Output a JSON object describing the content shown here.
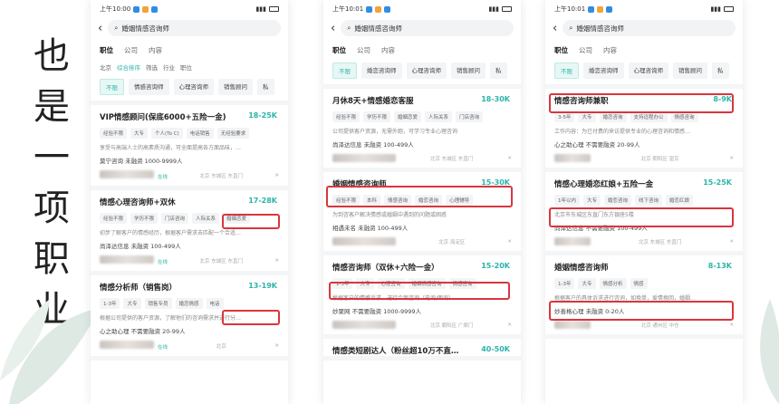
{
  "slide": {
    "vertical_text": [
      "也",
      "是",
      "一",
      "项",
      "职",
      "业"
    ]
  },
  "phones": [
    {
      "time": "上午10:00",
      "search_query": "婚姻情感咨询师",
      "tabs": [
        "职位",
        "公司",
        "内容"
      ],
      "filters": [
        "北京",
        "综合排序",
        "筛选",
        "行业",
        "职位"
      ],
      "chips": [
        "不限",
        "情感咨询师",
        "心理咨询师",
        "销售顾问",
        "私"
      ],
      "cards": [
        {
          "title": "VIP情感顾问(保底6000+五险一金)",
          "salary": "18-25K",
          "tags": [
            "经验不限",
            "大专",
            "个人(To C)",
            "电话销售",
            "无经验要求"
          ],
          "desc": "享受与高端人士的高素质沟通，可全面提高各方面品味，…",
          "company": "莫宁咨询  未融资  1000-9999人",
          "location": "北京 东城区 东直门",
          "status": "在线"
        },
        {
          "title": "情感心理咨询师+双休",
          "salary": "17-28K",
          "tags": [
            "经验不限",
            "学历不限",
            "门店咨询",
            "人际关系",
            "婚姻恋爱"
          ],
          "desc": "初步了解客户的情感经历，根据客户需求去匹配一个合适…",
          "company": "尚泽达信息  未融资  100-499人",
          "location": "北京 东城区 东直门",
          "status": "在线"
        },
        {
          "title": "情感分析师（销售岗）",
          "salary": "13-19K",
          "tags": [
            "1-3年",
            "大专",
            "销售专员",
            "婚恋情感",
            "电话"
          ],
          "desc": "根据公司提供的客户资源，了解他们的咨询需求并进行分…",
          "company": "心之助心理  不需要融资  20-99人",
          "location": "北京",
          "status": "在线"
        }
      ]
    },
    {
      "time": "上午10:01",
      "search_query": "婚姻情感咨询师",
      "tabs": [
        "职位",
        "公司",
        "内容"
      ],
      "chips": [
        "不限",
        "婚恋咨询师",
        "心理咨询师",
        "销售顾问",
        "私"
      ],
      "cards": [
        {
          "title": "月休8天+情感婚恋客服",
          "salary": "18-30K",
          "tags": [
            "经验不限",
            "学历不限",
            "婚姻恋爱",
            "人际关系",
            "门店咨询"
          ],
          "desc": "公司提供客户资源，无需外跑，可学习专业心理咨询",
          "company": "尚泽达信息  未融资  100-499人",
          "location": "北京 东城区 东直门",
          "status": ""
        },
        {
          "title": "婚姻情感咨询师",
          "salary": "15-30K",
          "tags": [
            "经验不限",
            "本科",
            "情感咨询",
            "婚恋咨询",
            "心理辅导"
          ],
          "desc": "为到咨客户解决情感或婚姻中遇到的问题或困惑",
          "company": "相遇未名  未融资  100-499人",
          "location": "北京 海淀区",
          "status": ""
        },
        {
          "title": "情感咨询师（双休+六险一金）",
          "salary": "15-20K",
          "tags": [
            "1-3年",
            "大专",
            "心理咨询",
            "婚姻情感咨询",
            "情感咨询"
          ],
          "desc": "根据客户的情感诉求，进行个案咨询（电询/面询）",
          "company": "妙聚网  不需要融资  1000-9999人",
          "location": "北京 朝阳区 广渠门",
          "status": ""
        },
        {
          "title": "情感类短剧达人（粉丝超10万不直…",
          "salary": "40-50K",
          "tags": [],
          "desc": "",
          "company": "",
          "location": "",
          "status": ""
        }
      ]
    },
    {
      "time": "上午10:01",
      "search_query": "婚姻情感咨询师",
      "tabs": [
        "职位",
        "公司",
        "内容"
      ],
      "chips": [
        "不限",
        "婚恋咨询师",
        "心理咨询师",
        "销售顾问",
        "私"
      ],
      "cards": [
        {
          "title": "情感咨询师兼职",
          "salary": "8-9K",
          "tags": [
            "3-5年",
            "大专",
            "婚恋咨询",
            "支持远程办公",
            "情感咨询"
          ],
          "desc": "工作内容：为已付费的来访提供专业的心理咨询和情感…",
          "company": "心之助心理  不需要融资  20-99人",
          "location": "北京 朝阳区 望京",
          "status": ""
        },
        {
          "title": "情感心理婚恋红娘+五险一金",
          "salary": "15-25K",
          "tags": [
            "1年以内",
            "大专",
            "婚恋咨询",
            "线下咨询",
            "婚恋红娘"
          ],
          "desc": "北京市东城区东直门东方银座5楼",
          "company": "尚泽达信息  不需要融资  100-499人",
          "location": "北京 东城区 东直门",
          "status": ""
        },
        {
          "title": "婚姻情感咨询师",
          "salary": "8-13K",
          "tags": [
            "1-3年",
            "大专",
            "情感分析",
            "情感"
          ],
          "desc": "根据客户的具体诉求进行咨询，如挽单，爱情挽回，婚姻…",
          "company": "妙善格心理  未融资  0-20人",
          "location": "北京 通州区 中仓",
          "status": ""
        }
      ]
    }
  ]
}
